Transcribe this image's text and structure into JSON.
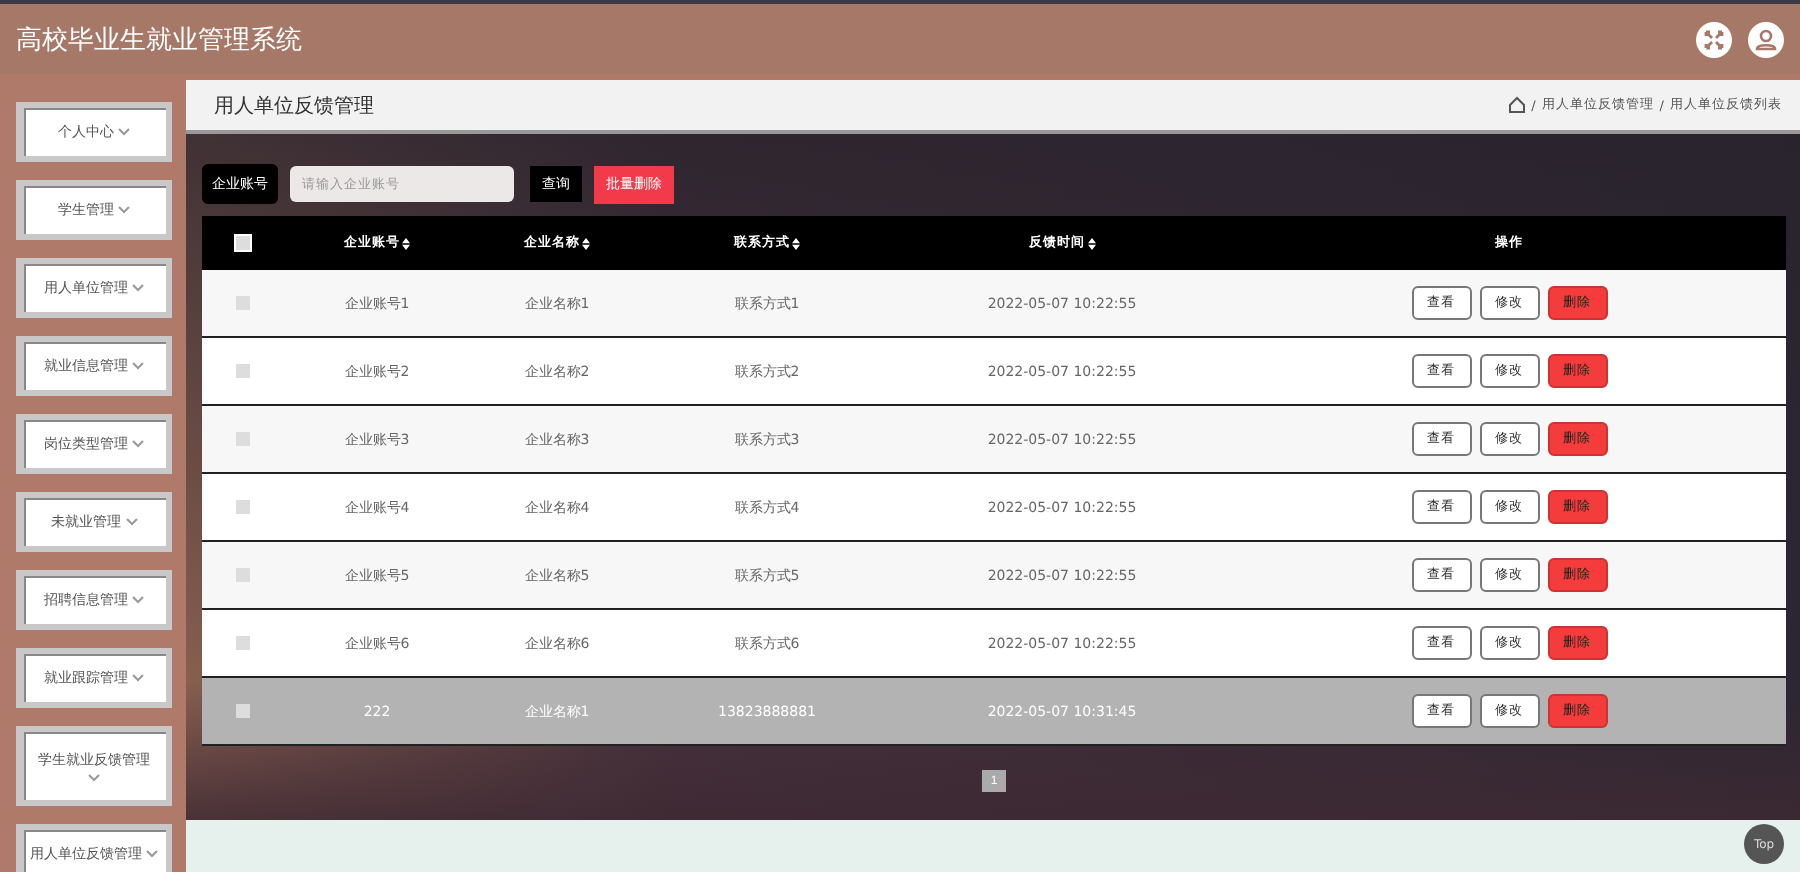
{
  "header": {
    "title": "高校毕业生就业管理系统"
  },
  "sidebar": {
    "items": [
      {
        "label": "个人中心"
      },
      {
        "label": "学生管理"
      },
      {
        "label": "用人单位管理"
      },
      {
        "label": "就业信息管理"
      },
      {
        "label": "岗位类型管理"
      },
      {
        "label": "未就业管理"
      },
      {
        "label": "招聘信息管理"
      },
      {
        "label": "就业跟踪管理"
      },
      {
        "label": "学生就业反馈管理"
      },
      {
        "label": "用人单位反馈管理"
      }
    ]
  },
  "page": {
    "title": "用人单位反馈管理",
    "breadcrumb": [
      {
        "separator": "/",
        "label": "用人单位反馈管理"
      },
      {
        "separator": "/",
        "label": "用人单位反馈列表"
      }
    ]
  },
  "search": {
    "label": "企业账号",
    "placeholder": "请输入企业账号",
    "query_button": "查询",
    "batch_delete_button": "批量删除"
  },
  "table": {
    "columns": [
      "企业账号",
      "企业名称",
      "联系方式",
      "反馈时间",
      "操作"
    ],
    "header_checked": false,
    "rows": [
      {
        "cells": [
          "企业账号1",
          "企业名称1",
          "联系方式1",
          "2022-05-07 10:22:55"
        ],
        "actions": [
          "查看",
          "修改",
          "删除"
        ],
        "checked": false,
        "highlighted": false
      },
      {
        "cells": [
          "企业账号2",
          "企业名称2",
          "联系方式2",
          "2022-05-07 10:22:55"
        ],
        "actions": [
          "查看",
          "修改",
          "删除"
        ],
        "checked": false,
        "highlighted": false
      },
      {
        "cells": [
          "企业账号3",
          "企业名称3",
          "联系方式3",
          "2022-05-07 10:22:55"
        ],
        "actions": [
          "查看",
          "修改",
          "删除"
        ],
        "checked": false,
        "highlighted": false
      },
      {
        "cells": [
          "企业账号4",
          "企业名称4",
          "联系方式4",
          "2022-05-07 10:22:55"
        ],
        "actions": [
          "查看",
          "修改",
          "删除"
        ],
        "checked": false,
        "highlighted": false
      },
      {
        "cells": [
          "企业账号5",
          "企业名称5",
          "联系方式5",
          "2022-05-07 10:22:55"
        ],
        "actions": [
          "查看",
          "修改",
          "删除"
        ],
        "checked": false,
        "highlighted": false
      },
      {
        "cells": [
          "企业账号6",
          "企业名称6",
          "联系方式6",
          "2022-05-07 10:22:55"
        ],
        "actions": [
          "查看",
          "修改",
          "删除"
        ],
        "checked": false,
        "highlighted": false
      },
      {
        "cells": [
          "222",
          "企业名称1",
          "13823888881",
          "2022-05-07 10:31:45"
        ],
        "actions": [
          "查看",
          "修改",
          "删除"
        ],
        "checked": false,
        "highlighted": true
      }
    ]
  },
  "pagination": {
    "pages": [
      {
        "label": "1",
        "selected": true
      }
    ]
  },
  "top_button": "Top"
}
